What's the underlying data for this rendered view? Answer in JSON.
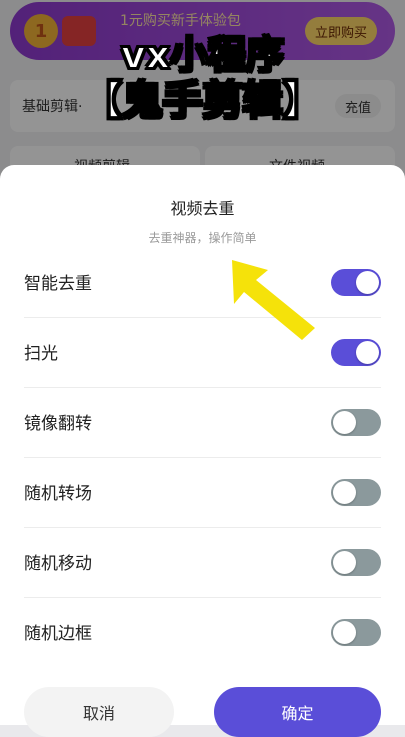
{
  "background": {
    "banner_text": "1元购买新手体验包",
    "banner_coin": "1",
    "banner_button": "立即购买",
    "row_left": "基础剪辑·",
    "row_right": "充值",
    "tab_left": "视频剪辑",
    "tab_right": "文件视频"
  },
  "overlay": {
    "line1": "vx小程序",
    "line2": "【鬼手剪辑】"
  },
  "sheet": {
    "title": "视频去重",
    "subtitle": "去重神器，操作简单",
    "options": [
      {
        "label": "智能去重",
        "on": true
      },
      {
        "label": "扫光",
        "on": true
      },
      {
        "label": "镜像翻转",
        "on": false
      },
      {
        "label": "随机转场",
        "on": false
      },
      {
        "label": "随机移动",
        "on": false
      },
      {
        "label": "随机边框",
        "on": false
      }
    ],
    "cancel_label": "取消",
    "confirm_label": "确定"
  },
  "colors": {
    "accent": "#5a4ed8",
    "toggle_off": "#8b999c",
    "arrow": "#f5e20a"
  }
}
